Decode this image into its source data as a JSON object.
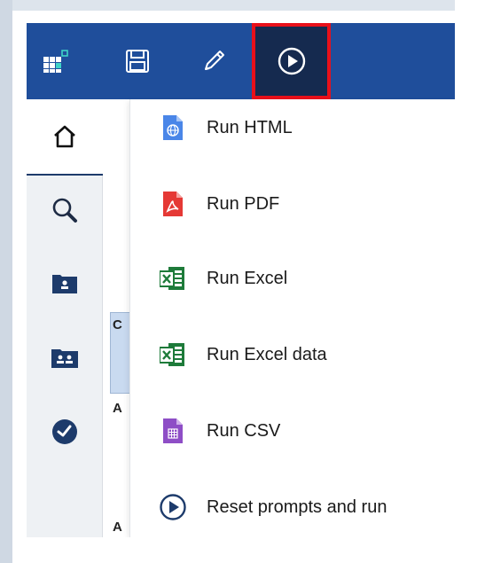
{
  "toolbar": {
    "logo_icon": "app-grid-logo-icon",
    "save_icon": "save-icon",
    "edit_icon": "pencil-icon",
    "run_icon": "play-circle-icon",
    "bar_color": "#1f4e9b",
    "highlight_color": "#e8101a"
  },
  "rail": {
    "items": [
      {
        "icon": "home-icon"
      },
      {
        "icon": "search-icon"
      },
      {
        "icon": "my-content-icon"
      },
      {
        "icon": "team-content-icon"
      },
      {
        "icon": "recent-icon"
      }
    ]
  },
  "background": {
    "letters": [
      "C",
      "A",
      "A"
    ]
  },
  "run_menu": {
    "items": [
      {
        "label": "Run HTML",
        "icon": "html-file-icon",
        "color": "#4a86e8"
      },
      {
        "label": "Run PDF",
        "icon": "pdf-file-icon",
        "color": "#e53935"
      },
      {
        "label": "Run Excel",
        "icon": "excel-file-icon",
        "color": "#1e7b3a"
      },
      {
        "label": "Run Excel data",
        "icon": "excel-data-file-icon",
        "color": "#1e7b3a"
      },
      {
        "label": "Run CSV",
        "icon": "csv-file-icon",
        "color": "#8e4ec6"
      },
      {
        "label": "Reset prompts and run",
        "icon": "play-circle-icon",
        "color": "#1d3b6b"
      }
    ]
  }
}
